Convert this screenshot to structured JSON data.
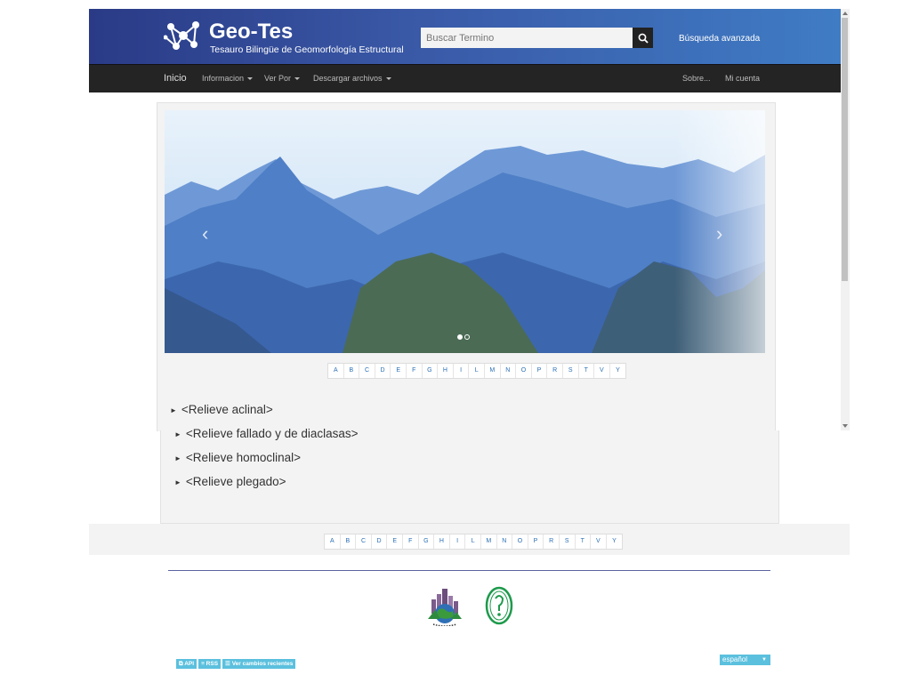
{
  "header": {
    "title": "Geo-Tes",
    "subtitle": "Tesauro Bilingüe de Geomorfología Estructural",
    "search_placeholder": "Buscar Termino",
    "advanced_search": "Búsqueda avanzada"
  },
  "nav": {
    "home": "Inicio",
    "info": "Informacion",
    "view_by": "Ver Por",
    "download": "Descargar archivos",
    "about": "Sobre...",
    "account": "Mi cuenta"
  },
  "alphabet": [
    "A",
    "B",
    "C",
    "D",
    "E",
    "F",
    "G",
    "H",
    "I",
    "L",
    "M",
    "N",
    "O",
    "P",
    "R",
    "S",
    "T",
    "V",
    "Y"
  ],
  "terms": [
    "<Relieve aclinal>",
    "<Relieve fallado y de diaclasas>",
    "<Relieve homoclinal>",
    "<Relieve plegado>"
  ],
  "footer": {
    "api": "API",
    "rss": "RSS",
    "changes": "Ver cambios recientes",
    "language": "español"
  },
  "colors": {
    "header_start": "#2a3a86",
    "header_end": "#3f7cc4",
    "nav_bg": "#242424",
    "link": "#2a6fb5",
    "badge": "#5bc0de"
  }
}
